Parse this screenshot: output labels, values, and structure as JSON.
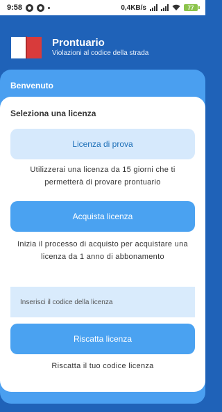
{
  "status_bar": {
    "time": "9:58",
    "network_speed": "0,4KB/s",
    "battery_level": "77"
  },
  "header": {
    "title": "Prontuario",
    "subtitle": "Violazioni al codice della strada",
    "icon": "book-icon"
  },
  "welcome": {
    "label": "Benvenuto"
  },
  "license": {
    "section_title": "Seleziona una licenza",
    "trial_button": "Licenza di prova",
    "trial_description": "Utilizzerai una licenza da 15 giorni che ti permetterà di provare prontuario",
    "buy_button": "Acquista licenza",
    "buy_description": "Inizia il processo di acquisto per acquistare una licenza da 1 anno di abbonamento",
    "code_placeholder": "Inserisci il codice della licenza",
    "redeem_button": "Riscatta licenza",
    "redeem_description": "Riscatta il tuo codice licenza"
  },
  "colors": {
    "primary_dark": "#1f62b8",
    "primary": "#4aa2f1",
    "primary_light": "#d6e9fc",
    "book_red": "#d83b3b"
  }
}
